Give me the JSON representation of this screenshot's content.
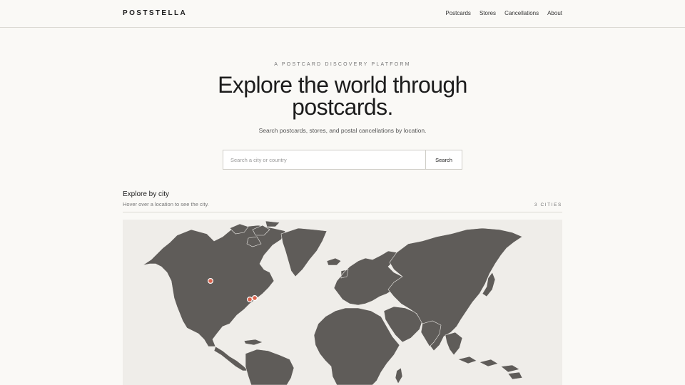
{
  "brand": "POSTSTELLA",
  "nav": [
    "Postcards",
    "Stores",
    "Cancellations",
    "About"
  ],
  "hero": {
    "eyebrow": "A POSTCARD DISCOVERY PLATFORM",
    "title": "Explore the world through postcards.",
    "subtitle": "Search postcards, stores, and postal cancellations by location."
  },
  "search": {
    "placeholder": "Search a city or country",
    "value": "",
    "button_label": "Search"
  },
  "explore": {
    "title": "Explore by city",
    "subtitle": "Hover over a location to see the city.",
    "count_label": "3 CITIES"
  },
  "colors": {
    "background": "#faf9f6",
    "land": "#5f5c59",
    "ocean": "#efede9",
    "marker": "#d9634c"
  }
}
